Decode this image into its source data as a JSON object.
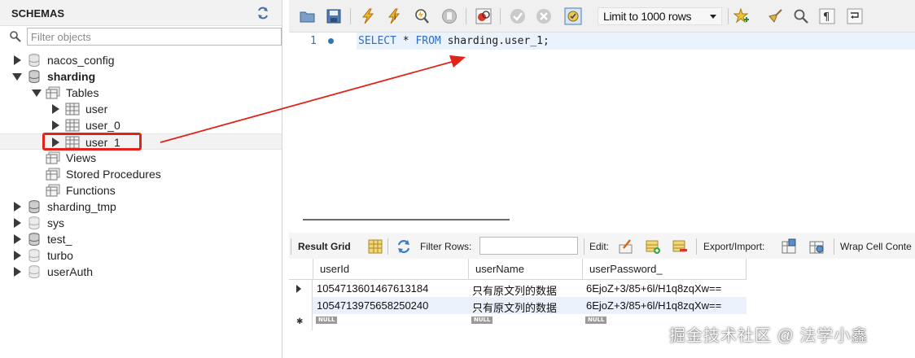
{
  "schemas": {
    "title": "SCHEMAS",
    "filter_placeholder": "Filter objects",
    "tree": [
      {
        "label": "nacos_config",
        "bold": false
      },
      {
        "label": "sharding",
        "bold": true
      },
      {
        "label": "Tables",
        "bold": false
      },
      {
        "label": "user",
        "bold": false
      },
      {
        "label": "user_0",
        "bold": false
      },
      {
        "label": "user_1",
        "bold": false
      },
      {
        "label": "Views",
        "bold": false
      },
      {
        "label": "Stored Procedures",
        "bold": false
      },
      {
        "label": "Functions",
        "bold": false
      },
      {
        "label": "sharding_tmp",
        "bold": false
      },
      {
        "label": "sys",
        "bold": false
      },
      {
        "label": "test_",
        "bold": false
      },
      {
        "label": "turbo",
        "bold": false
      },
      {
        "label": "userAuth",
        "bold": false
      }
    ]
  },
  "toolbar": {
    "limit_value": "Limit to 1000 rows"
  },
  "editor": {
    "line_number": "1",
    "sql_keyword_select": "SELECT",
    "sql_star": " * ",
    "sql_keyword_from": "FROM",
    "sql_rest": " sharding.user_1;"
  },
  "results": {
    "result_grid_label": "Result Grid",
    "filter_rows_label": "Filter Rows:",
    "edit_label": "Edit:",
    "export_import_label": "Export/Import:",
    "wrap_label": "Wrap Cell Conte",
    "columns": [
      "userId",
      "userName",
      "userPassword_"
    ],
    "rows": [
      [
        "1054713601467613184",
        "只有原文列的数据",
        "6EjoZ+3/85+6l/H1q8zqXw=="
      ],
      [
        "1054713975658250240",
        "只有原文列的数据",
        "6EjoZ+3/85+6l/H1q8zqXw=="
      ]
    ],
    "null_text": "NULL"
  },
  "watermark": "掘金技术社区 @ 法学小鑫",
  "colors": {
    "highlight_red": "#e2231a",
    "keyword_blue": "#2f6cc6",
    "selection_row": "#eaf1fa"
  }
}
